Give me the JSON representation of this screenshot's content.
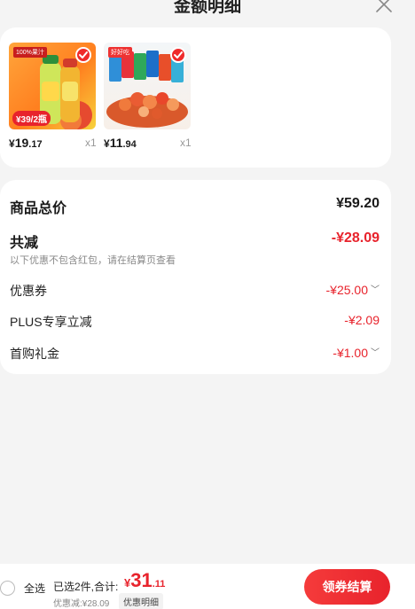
{
  "header": {
    "title": "金额明细"
  },
  "products": [
    {
      "badge": "100%果汁",
      "promo": "¥39/2瓶",
      "price_currency": "¥",
      "price_int": "19",
      "price_dec": ".17",
      "qty": "x1"
    },
    {
      "badge": "好好吃",
      "promo": "",
      "price_currency": "¥",
      "price_int": "11",
      "price_dec": ".94",
      "qty": "x1"
    }
  ],
  "summary": {
    "total_label": "商品总价",
    "total_value": "¥59.20",
    "reduction_label": "共减",
    "reduction_value": "-¥28.09",
    "reduction_note": "以下优惠不包含红包，请在结算页查看",
    "items": [
      {
        "label": "优惠券",
        "value": "-¥25.00",
        "expandable": true
      },
      {
        "label": "PLUS专享立减",
        "value": "-¥2.09",
        "expandable": false
      },
      {
        "label": "首购礼金",
        "value": "-¥1.00",
        "expandable": true
      }
    ]
  },
  "bottom_bar": {
    "select_all": "全选",
    "selected_text": "已选2件,合计:",
    "total_currency": "¥",
    "total_int": "31",
    "total_dec": ".11",
    "discount_note": "优惠减:¥28.09",
    "detail_link": "优惠明细",
    "checkout_label": "领券结算"
  },
  "colors": {
    "accent_red": "#e8232c",
    "background": "#f4f4f4"
  },
  "icons": {
    "close": "close-icon",
    "check": "check-icon",
    "chevron": "chevron-down-icon"
  }
}
